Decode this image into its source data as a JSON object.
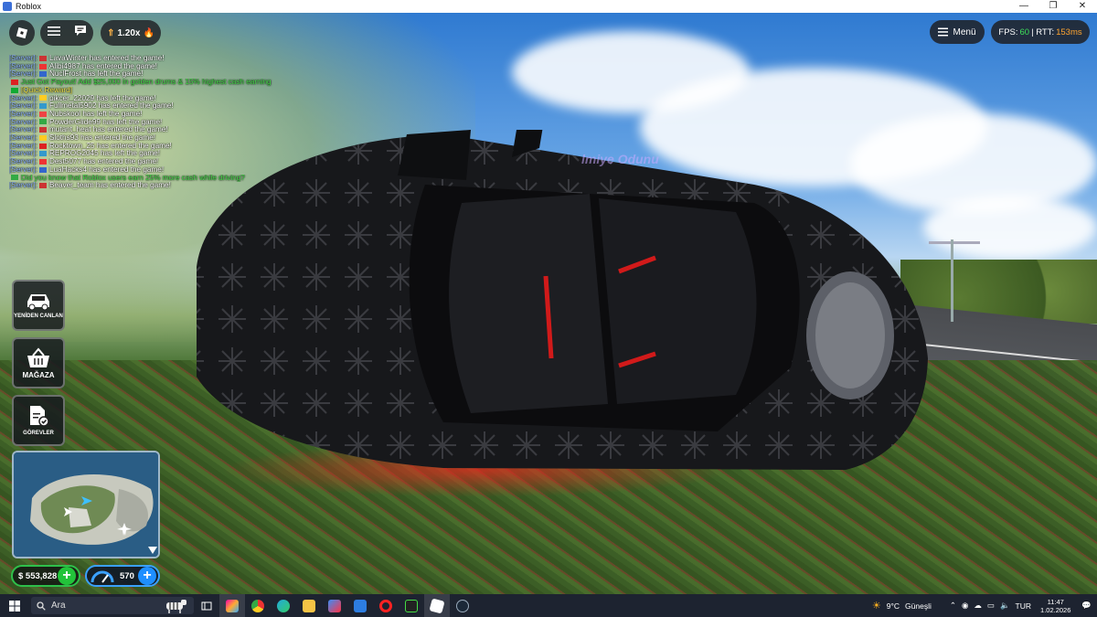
{
  "window": {
    "title": "Roblox",
    "controls": [
      "—",
      "❐",
      "✕"
    ]
  },
  "hud": {
    "boost_label": "1.20x",
    "menu_label": "Menü",
    "fps_label": "FPS:",
    "fps_value": "60",
    "rtt_label": "| RTT:",
    "rtt_value": "153ms",
    "watermark": "lmiye Odunu"
  },
  "chat": {
    "lines": [
      {
        "prefix": "[Server]:",
        "text": "LavaWinter has entered the game!",
        "color": "white"
      },
      {
        "prefix": "[Server]:",
        "text": "Alibi4987 has entered the game!",
        "color": "white"
      },
      {
        "prefix": "[Server]:",
        "text": "NuclFrost has left the game!",
        "color": "white"
      },
      {
        "prefix": "",
        "text": "Just Got Payout! Add $25,000 in golden drums & 15% highest cash earning",
        "color": "green"
      },
      {
        "prefix": "",
        "text": "[Quick Reward]",
        "color": "yellow"
      },
      {
        "prefix": "[Server]:",
        "text": "pikcer_22029 has left the game!",
        "color": "white"
      },
      {
        "prefix": "[Server]:",
        "text": "Fullmetal5902 has entered the game!",
        "color": "white"
      },
      {
        "prefix": "[Server]:",
        "text": "Nubskool has left the game!",
        "color": "white"
      },
      {
        "prefix": "[Server]:",
        "text": "PowderGlide99 has left the game!",
        "color": "white"
      },
      {
        "prefix": "[Server]:",
        "text": "mutant_heat has entered the game!",
        "color": "white"
      },
      {
        "prefix": "[Server]:",
        "text": "Sloths93 has entered the game!",
        "color": "white"
      },
      {
        "prefix": "[Server]:",
        "text": "Rocktown_25 has entered the game!",
        "color": "white"
      },
      {
        "prefix": "[Server]:",
        "text": "REPROG2045 has left the game!",
        "color": "white"
      },
      {
        "prefix": "[Server]:",
        "text": "Dest5077 has entered the game!",
        "color": "white"
      },
      {
        "prefix": "[Server]:",
        "text": "LuaHacks4 has entered the game!",
        "color": "white"
      },
      {
        "prefix": "",
        "text": "Did you know that Roblox users earn 25% more cash while driving?",
        "color": "green"
      },
      {
        "prefix": "[Server]:",
        "text": "Beaver_team has entered the game!",
        "color": "white"
      }
    ]
  },
  "sidebar": {
    "respawn_label": "YENİDEN CANLAN",
    "shop_label": "MAĞAZA",
    "missions_label": "GÖREVLER"
  },
  "stats": {
    "money": "$ 553,828",
    "speed": "570"
  },
  "taskbar": {
    "search_placeholder": "Ara",
    "weather_temp": "9°C",
    "weather_desc": "Güneşli",
    "language": "TUR",
    "time": "11:47",
    "date": "1.02.2026"
  },
  "colors": {
    "fps_green": "#3ee05a",
    "rtt_orange": "#ffa530",
    "money_green": "#22c43a",
    "speed_blue": "#1e8fff"
  }
}
